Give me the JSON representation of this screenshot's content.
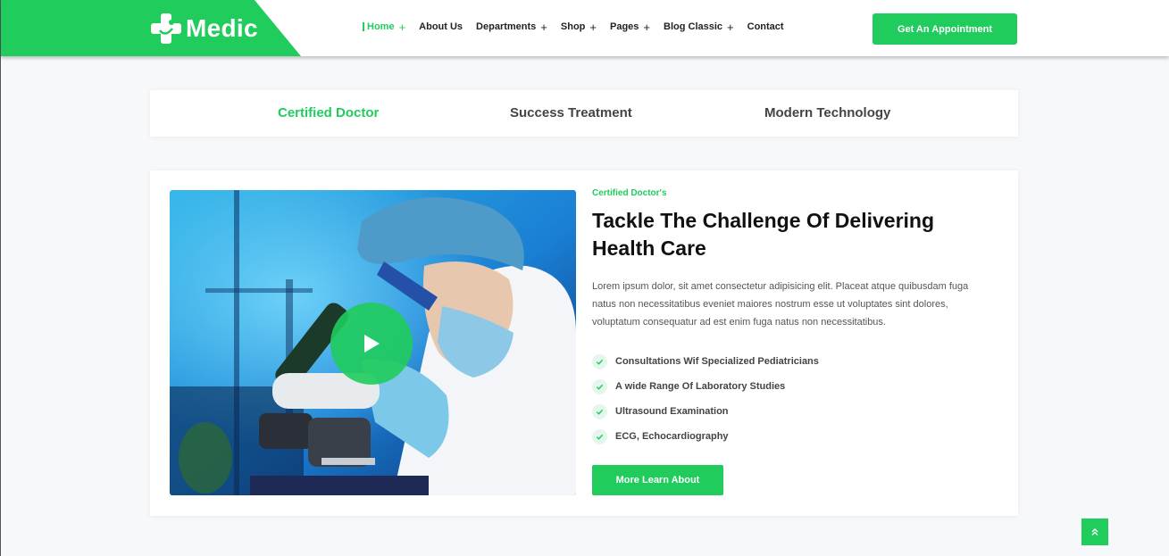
{
  "brand": {
    "name": "Medic",
    "accent": "#1fcc5c"
  },
  "nav": {
    "items": [
      {
        "label": "Home",
        "has_submenu": true,
        "active": true
      },
      {
        "label": "About Us",
        "has_submenu": false
      },
      {
        "label": "Departments",
        "has_submenu": true
      },
      {
        "label": "Shop",
        "has_submenu": true
      },
      {
        "label": "Pages",
        "has_submenu": true
      },
      {
        "label": "Blog Classic",
        "has_submenu": true
      },
      {
        "label": "Contact",
        "has_submenu": false
      }
    ],
    "submenu_glyph": "+",
    "cta_label": "Get An Appointment"
  },
  "tabs": [
    {
      "label": "Certified Doctor",
      "active": true
    },
    {
      "label": "Success Treatment"
    },
    {
      "label": "Modern Technology"
    }
  ],
  "content": {
    "eyebrow": "Certified Doctor's",
    "headline": "Tackle The Challenge Of Delivering Health Care",
    "paragraph": "Lorem ipsum dolor, sit amet consectetur adipisicing elit. Placeat atque quibusdam fuga natus non necessitatibus eveniet maiores nostrum esse ut voluptates sint dolores, voluptatum consequatur ad est enim fuga natus non necessitatibus.",
    "features": [
      "Consultations Wif Specialized Pediatricians",
      "A wide Range Of Laboratory Studies",
      "Ultrasound Examination",
      "ECG, Echocardiography"
    ],
    "button_label": "More Learn About",
    "media_icon": "play-icon"
  },
  "scroll_top_icon": "double-chevron-up-icon"
}
